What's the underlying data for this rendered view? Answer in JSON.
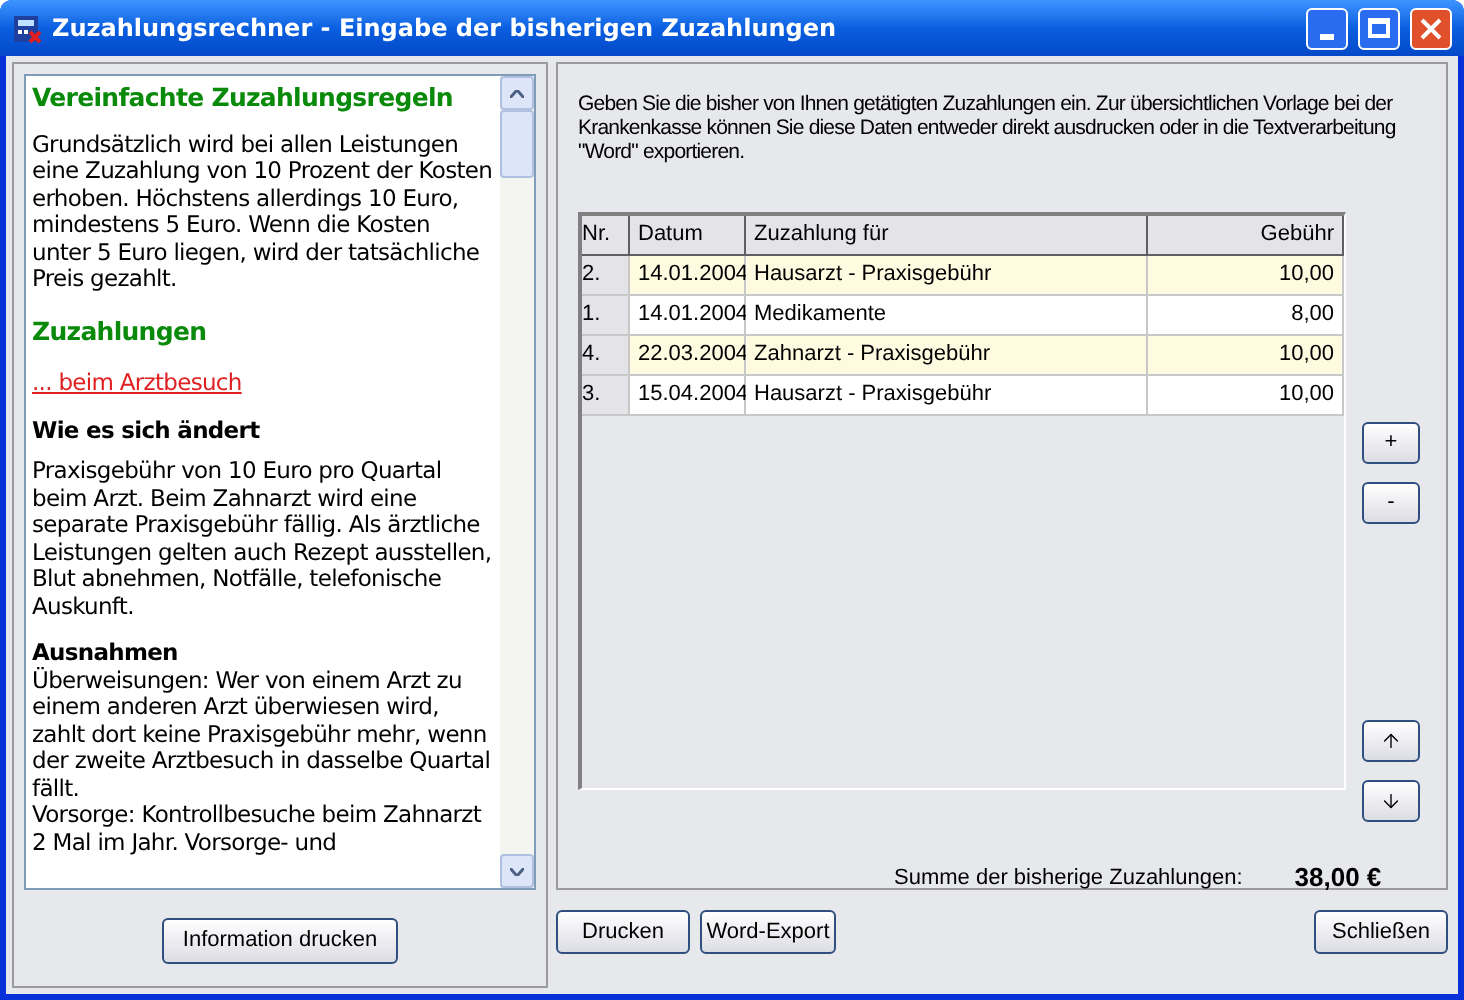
{
  "window": {
    "title": "Zuzahlungsrechner - Eingabe der bisherigen Zuzahlungen"
  },
  "info": {
    "blocks": [
      {
        "kind": "heading",
        "text": "Vereinfachte Zuzahlungsregeln"
      },
      {
        "kind": "paragraph",
        "text": "Grundsätzlich wird bei allen Leistungen eine Zuzahlung von 10 Prozent der Kosten erhoben. Höchstens allerdings 10 Euro, mindestens 5 Euro. Wenn die Kosten unter 5 Euro liegen, wird der tatsächliche Preis gezahlt."
      },
      {
        "kind": "heading",
        "text": "Zuzahlungen"
      },
      {
        "kind": "link",
        "text": "... beim Arztbesuch"
      },
      {
        "kind": "subheading",
        "text": "Wie es sich ändert"
      },
      {
        "kind": "paragraph",
        "text": "Praxisgebühr von 10 Euro pro Quartal beim Arzt. Beim Zahnarzt wird eine separate Praxisgebühr fällig. Als ärztliche Leistungen gelten auch Rezept ausstellen, Blut abnehmen, Notfälle, telefonische Auskunft."
      },
      {
        "kind": "label",
        "text": "Ausnahmen"
      },
      {
        "kind": "line",
        "text": "Überweisungen: Wer von einem Arzt zu einem anderen Arzt überwiesen wird, zahlt dort keine Praxisgebühr mehr, wenn der zweite Arztbesuch in dasselbe Quartal fällt."
      },
      {
        "kind": "line",
        "text": "Vorsorge: Kontrollbesuche beim Zahnarzt 2 Mal im Jahr. Vorsorge- und"
      }
    ],
    "print_button": "Information drucken"
  },
  "intro": "Geben Sie die bisher von Ihnen getätigten Zuzahlungen ein. Zur übersichtlichen Vorlage bei der Krankenkasse können Sie diese Daten entweder direkt ausdrucken oder in die Textverarbeitung \"Word\" exportieren.",
  "table": {
    "columns": [
      "Nr.",
      "Datum",
      "Zuzahlung für",
      "Gebühr"
    ],
    "rows": [
      [
        "2.",
        "14.01.2004",
        "Hausarzt - Praxisgebühr",
        "10,00"
      ],
      [
        "1.",
        "14.01.2004",
        "Medikamente",
        "8,00"
      ],
      [
        "4.",
        "22.03.2004",
        "Zahnarzt - Praxisgebühr",
        "10,00"
      ],
      [
        "3.",
        "15.04.2004",
        "Hausarzt - Praxisgebühr",
        "10,00"
      ]
    ]
  },
  "side_buttons": [
    {
      "kind": "add",
      "label": "+"
    },
    {
      "kind": "remove",
      "label": "-"
    },
    {
      "kind": "up"
    },
    {
      "kind": "down"
    }
  ],
  "sum": {
    "label": "Summe der bisherige Zuzahlungen:",
    "value": "38,00 €"
  },
  "buttons": [
    "Drucken",
    "Word-Export",
    "Schließen"
  ]
}
